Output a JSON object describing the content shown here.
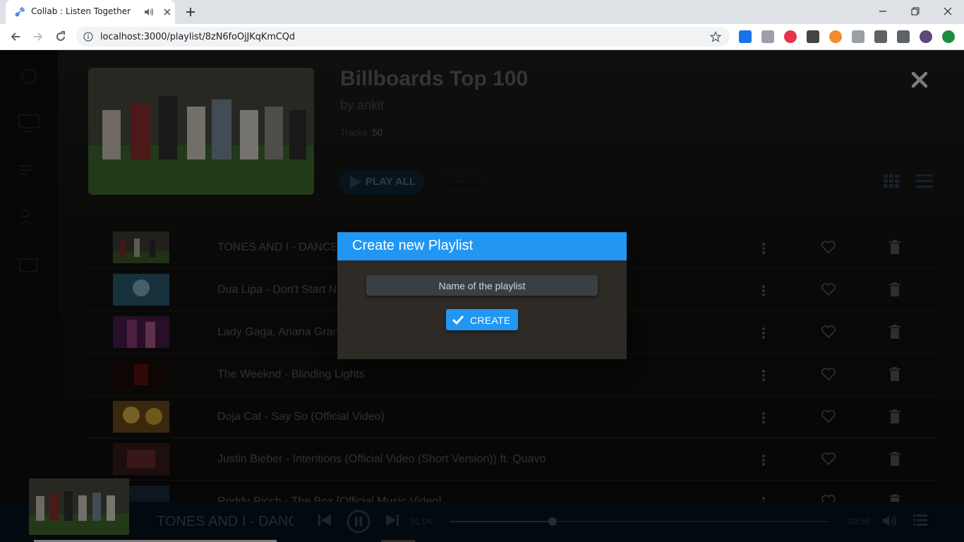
{
  "browser": {
    "tab_title": "Collab : Listen Together",
    "url": "localhost:3000/playlist/8zN6foOjJKqKmCQd"
  },
  "playlist": {
    "title": "Billboards Top 100",
    "by": "by ankit",
    "tracks_label": "Tracks :",
    "tracks_count": "50",
    "play_all": "PLAY ALL",
    "more": "···"
  },
  "tracks": [
    {
      "title": "TONES AND I - DANCE MONKEY (OFFICIAL VIDEO)"
    },
    {
      "title": "Dua Lipa - Don't Start Now (Official Music Video)"
    },
    {
      "title": "Lady Gaga, Ariana Grande - Rain On Me (Official Music Video)"
    },
    {
      "title": "The Weeknd - Blinding Lights"
    },
    {
      "title": "Doja Cat - Say So (Official Video)"
    },
    {
      "title": "Justin Bieber - Intentions (Official Video (Short Version)) ft. Quavo"
    },
    {
      "title": "Roddy Ricch - The Box [Official Music Video]"
    }
  ],
  "player": {
    "now_playing": "TONES AND I - DANCE MONKEY (OFFICIAL VIDEO)",
    "current_time": "01:04",
    "total_time": "03:56",
    "progress_fraction": 0.27
  },
  "modal": {
    "title": "Create new Playlist",
    "input_placeholder": "Name of the playlist",
    "input_value": "",
    "create_label": "CREATE"
  },
  "colors": {
    "accent": "#2196f3",
    "modal_bg": "#2e2a26",
    "app_bg": "#141312"
  },
  "icons": [
    "close-icon",
    "grid-view-icon",
    "list-view-icon",
    "more-vert-icon",
    "heart-icon",
    "trash-icon",
    "check-icon",
    "prev-icon",
    "pause-icon",
    "next-icon",
    "volume-icon",
    "queue-icon"
  ]
}
